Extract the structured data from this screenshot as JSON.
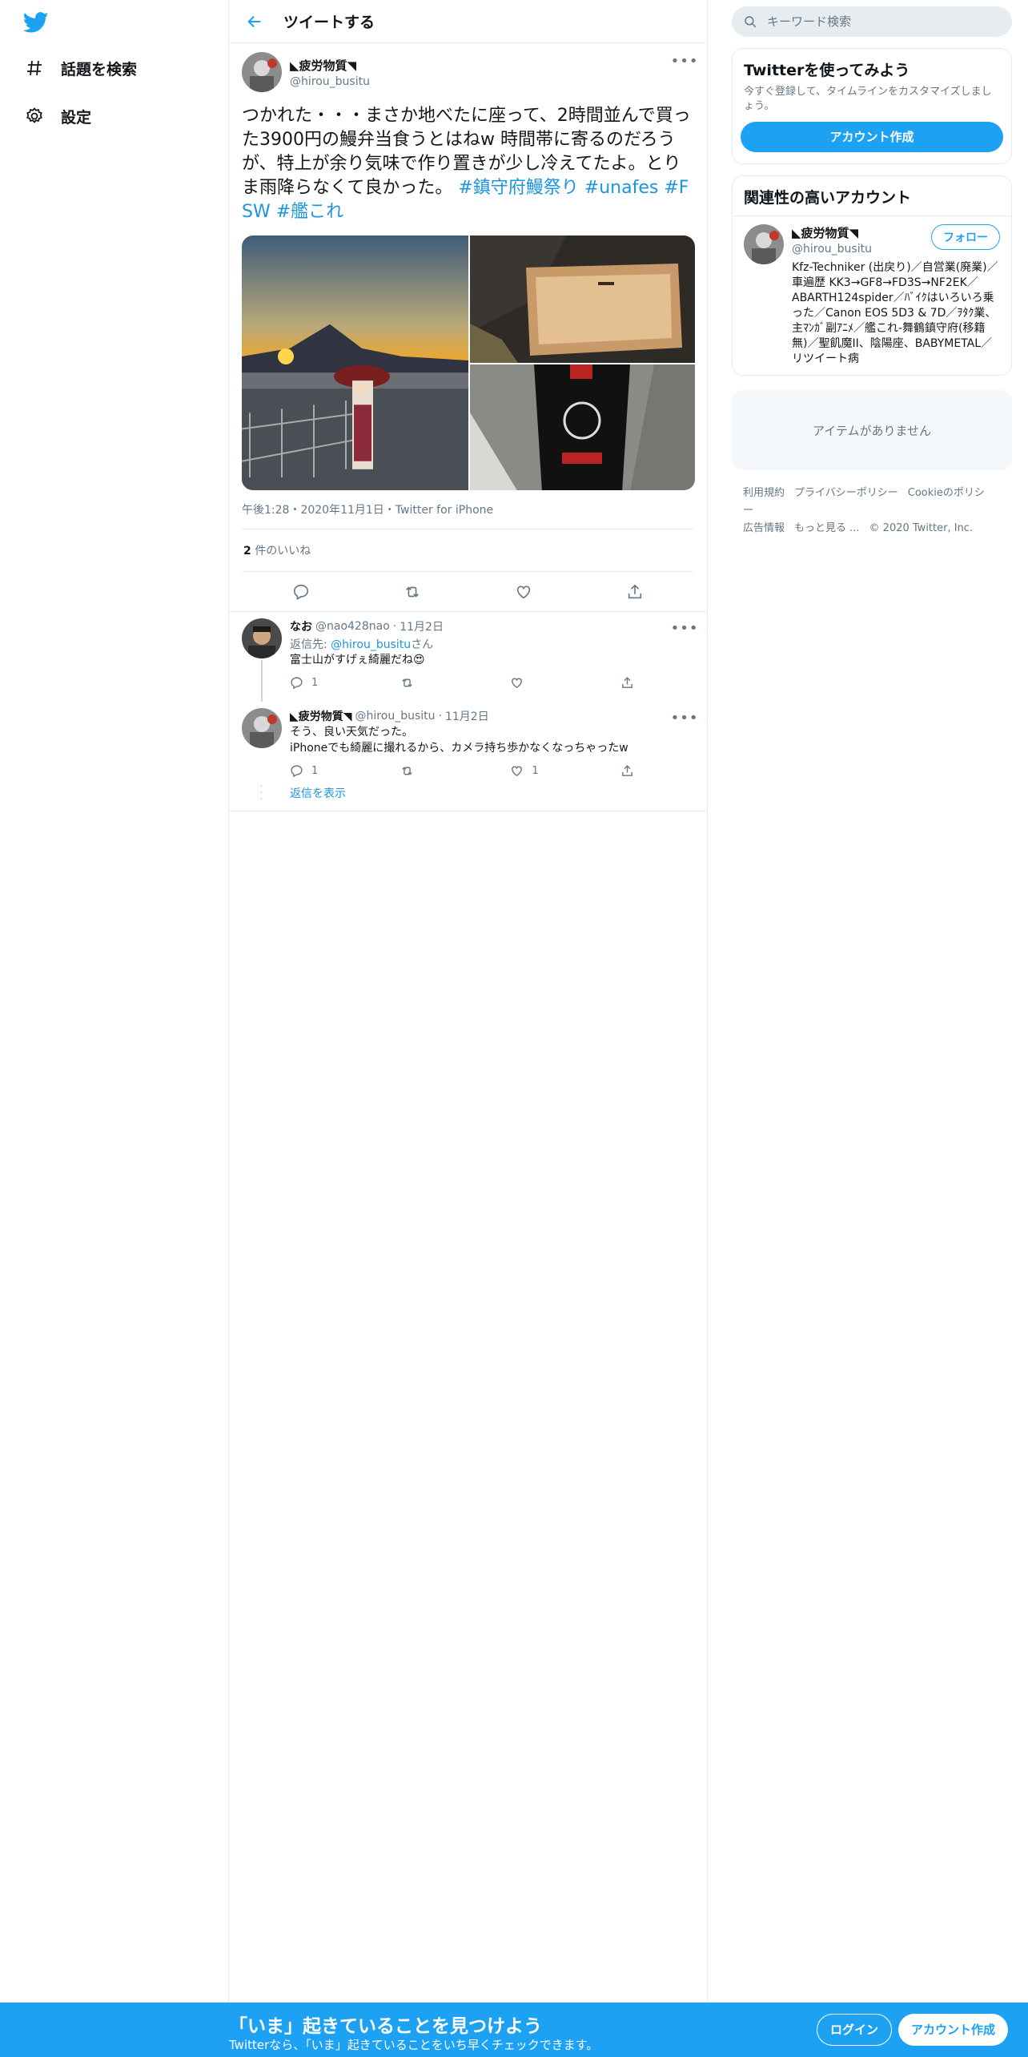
{
  "nav": {
    "logo_icon": "twitter-bird-icon",
    "items": [
      {
        "label": "話題を検索",
        "icon": "hashtag-icon"
      },
      {
        "label": "設定",
        "icon": "gear-icon"
      }
    ]
  },
  "header": {
    "title": "ツイートする"
  },
  "tweet": {
    "name": "◣疲労物質◥",
    "handle": "@hirou_busitu",
    "text": "つかれた・・・まさか地べたに座って、2時間並んで買った3900円の鰻弁当食うとはねw 時間帯に寄るのだろうが、特上が余り気味で作り置きが少し冷えてたよ。とりま雨降らなくて良かった。",
    "hashtags": [
      "#鎮守府鰻祭り",
      "#unafes",
      "#FSW",
      "#艦これ"
    ],
    "meta": "午後1:28・2020年11月1日・Twitter for iPhone",
    "likes_count": "2",
    "likes_label": " 件のいいね"
  },
  "replies": [
    {
      "name": "なお",
      "handle": "@nao428nao",
      "date": "11月2日",
      "replying_prefix": "返信先: ",
      "replying_to": "@hirou_busitu",
      "replying_suffix": "さん",
      "text": "富士山がすげぇ綺麗だね😍",
      "reply_count": "1",
      "retweet_count": "",
      "like_count": ""
    },
    {
      "name": "◣疲労物質◥",
      "handle": "@hirou_busitu",
      "date": "11月2日",
      "text_line1": "そう、良い天気だった。",
      "text_line2": "iPhoneでも綺麗に撮れるから、カメラ持ち歩かなくなっちゃったw",
      "reply_count": "1",
      "retweet_count": "",
      "like_count": "1"
    }
  ],
  "show_replies": "返信を表示",
  "sidebar": {
    "search_placeholder": "キーワード検索",
    "signup_card": {
      "title": "Twitterを使ってみよう",
      "subtitle": "今すぐ登録して、タイムラインをカスタマイズしましょう。",
      "button": "アカウント作成"
    },
    "related": {
      "title": "関連性の高いアカウント",
      "name": "◣疲労物質◥",
      "handle": "@hirou_busitu",
      "follow": "フォロー",
      "bio": "Kfz-Techniker (出戻り)／自営業(廃業)／車遍歴 KK3→GF8→FD3S→NF2EK／ABARTH124spider／ﾊﾞｲｸはいろいろ乗った／Canon EOS 5D3 & 7D／ｦﾀｸ業、主ﾏﾝｶﾞ副ｱﾆﾒ／艦これ-舞鶴鎮守府(移籍無)／聖飢魔II、陰陽座、BABYMETAL／リツイート病"
    },
    "empty": "アイテムがありません",
    "footer": [
      "利用規約",
      "プライバシーポリシー",
      "Cookieのポリシー",
      "広告情報",
      "もっと見る ...",
      "© 2020 Twitter, Inc."
    ]
  },
  "bottom_bar": {
    "title": "「いま」起きていることを見つけよう",
    "subtitle": "Twitterなら、「いま」起きていることをいち早くチェックできます。",
    "login": "ログイン",
    "signup": "アカウント作成"
  },
  "colors": {
    "accent": "#1da1f2",
    "link": "#1b95e0",
    "secondary": "#657786"
  }
}
